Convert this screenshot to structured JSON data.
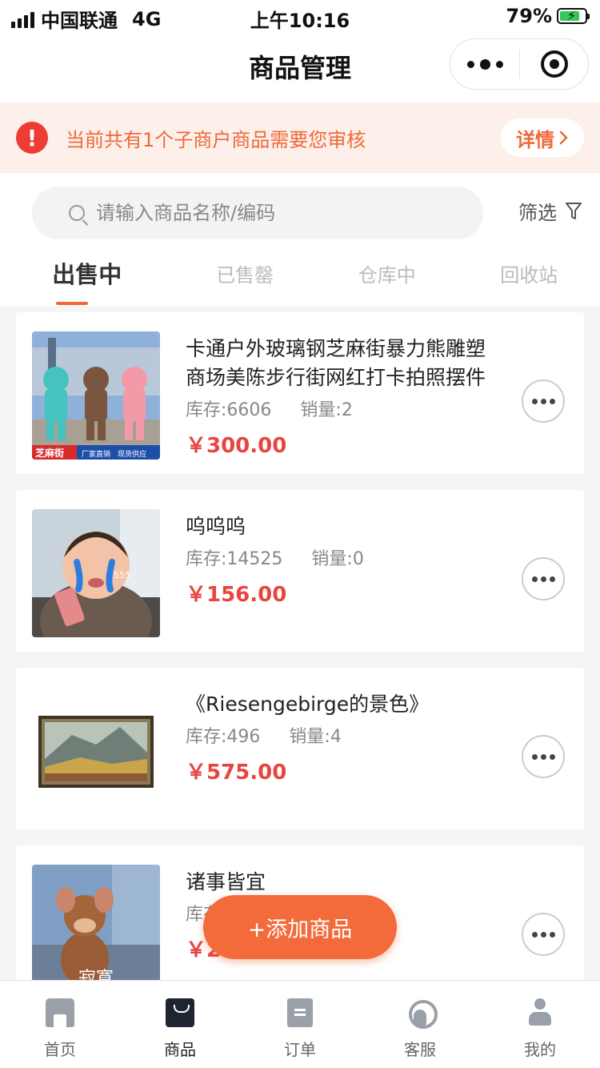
{
  "status_bar": {
    "carrier": "中国联通",
    "network": "4G",
    "time": "上午10:16",
    "battery": "79%",
    "battery_level": 0.79
  },
  "nav": {
    "title": "商品管理"
  },
  "notice": {
    "text": "当前共有1个子商户商品需要您审核",
    "button": "详情",
    "icon": "!"
  },
  "search": {
    "placeholder": "请输入商品名称/编码",
    "filter_label": "筛选"
  },
  "tabs": [
    {
      "label": "出售中",
      "active": true
    },
    {
      "label": "已售罄",
      "active": false
    },
    {
      "label": "仓库中",
      "active": false
    },
    {
      "label": "回收站",
      "active": false
    }
  ],
  "products": [
    {
      "name": "卡通户外玻璃钢芝麻街暴力熊雕塑商场美陈步行街网红打卡拍照摆件",
      "stock": "库存:6606",
      "sales": "销量:2",
      "price": "￥300.00",
      "thumb_caption": "芝麻街",
      "thumb_tags": "厂家直销　现货供应"
    },
    {
      "name": "呜呜呜",
      "stock": "库存:14525",
      "sales": "销量:0",
      "price": "￥156.00",
      "thumb_caption": "555"
    },
    {
      "name": "《Riesengebirge的景色》",
      "stock": "库存:496",
      "sales": "销量:4",
      "price": "￥575.00"
    },
    {
      "name": "诸事皆宜",
      "stock": "库存",
      "sales": "",
      "price": "￥230.00",
      "thumb_caption": "寂寞"
    }
  ],
  "fab": {
    "label": "+添加商品"
  },
  "tabbar": [
    {
      "label": "首页",
      "icon": "home-icon",
      "active": false
    },
    {
      "label": "商品",
      "icon": "bag-icon",
      "active": true
    },
    {
      "label": "订单",
      "icon": "order-icon",
      "active": false
    },
    {
      "label": "客服",
      "icon": "service-icon",
      "active": false
    },
    {
      "label": "我的",
      "icon": "user-icon",
      "active": false
    }
  ],
  "colors": {
    "accent": "#f0683a",
    "price": "#e8453f",
    "alert": "#ee3b34",
    "notice_bg": "#fdf0ea"
  }
}
